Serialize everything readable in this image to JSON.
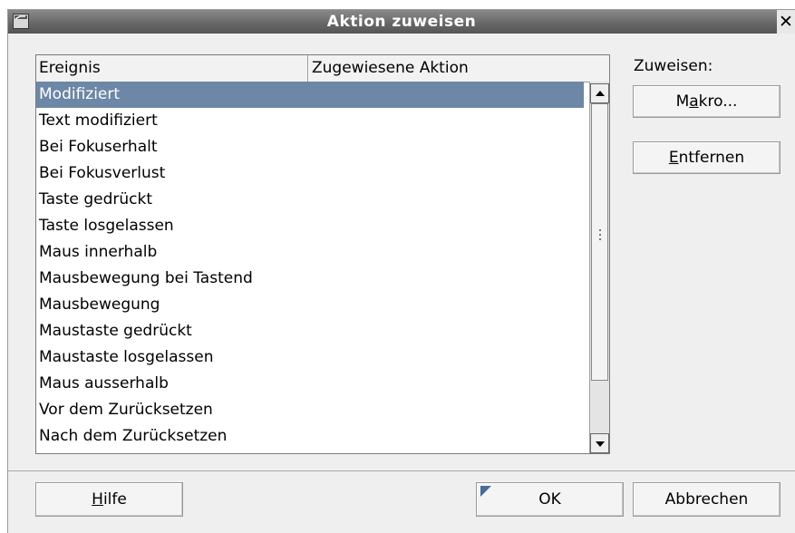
{
  "dialog": {
    "title": "Aktion zuweisen",
    "close_glyph": "✕"
  },
  "table": {
    "headers": [
      "Ereignis",
      "Zugewiesene Aktion"
    ],
    "rows": [
      {
        "event": "Modifiziert",
        "selected": true
      },
      {
        "event": "Text modifiziert"
      },
      {
        "event": "Bei Fokuserhalt"
      },
      {
        "event": "Bei Fokusverlust"
      },
      {
        "event": "Taste gedrückt"
      },
      {
        "event": "Taste losgelassen"
      },
      {
        "event": "Maus innerhalb"
      },
      {
        "event": "Mausbewegung bei Tastend"
      },
      {
        "event": "Mausbewegung"
      },
      {
        "event": "Maustaste gedrückt"
      },
      {
        "event": "Maustaste losgelassen"
      },
      {
        "event": "Maus ausserhalb"
      },
      {
        "event": "Vor dem Zurücksetzen"
      },
      {
        "event": "Nach dem Zurücksetzen"
      }
    ]
  },
  "assign": {
    "label": "Zuweisen:",
    "macro_button": {
      "before": "M",
      "mnemonic": "a",
      "after": "kro..."
    },
    "remove_button": {
      "before": "",
      "mnemonic": "E",
      "after": "ntfernen"
    }
  },
  "footer": {
    "help_button": {
      "before": "",
      "mnemonic": "H",
      "after": "ilfe"
    },
    "ok_button": "OK",
    "cancel_button": "Abbrechen"
  },
  "colors": {
    "selection": "#6d87a6",
    "titlebar": "#666666"
  },
  "icons": {
    "window": "window-menu-icon",
    "close": "close-icon",
    "scroll_up": "scroll-up-arrow-icon",
    "scroll_down": "scroll-down-arrow-icon"
  }
}
